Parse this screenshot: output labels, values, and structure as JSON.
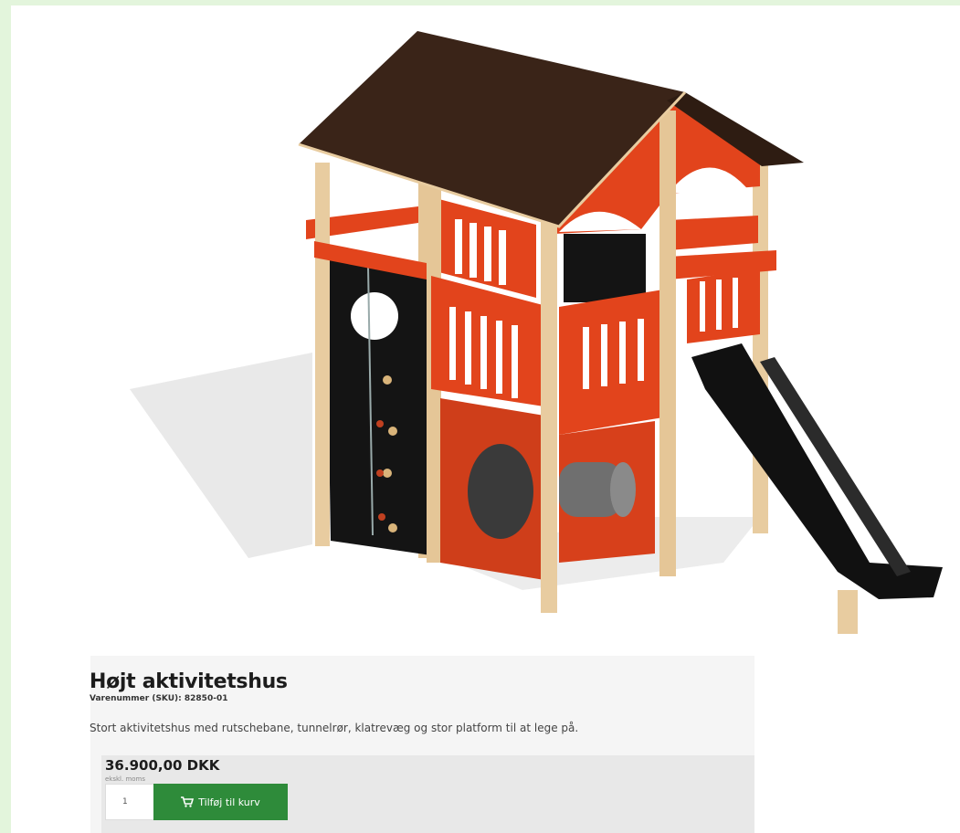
{
  "product": {
    "title": "Højt aktivitetshus",
    "sku": "Varenummer (SKU): 82850-01",
    "description": "Stort aktivitetshus med rutschebane, tunnelrør, klatrevæg og stor platform til at lege på.",
    "price": "36.900,00 DKK",
    "vat_note": "ekskl. moms",
    "quantity": "1",
    "add_to_cart_label": "Tilføj til kurv",
    "cart_icon": "shopping-cart-icon"
  },
  "colors": {
    "page_background": "#e3f5dc",
    "roof": "#3a2418",
    "panel_orange": "#e2441c",
    "wood": "#e8cca0",
    "climbing_wall": "#141414",
    "slide": "#111111",
    "button": "#2e8b3a"
  }
}
